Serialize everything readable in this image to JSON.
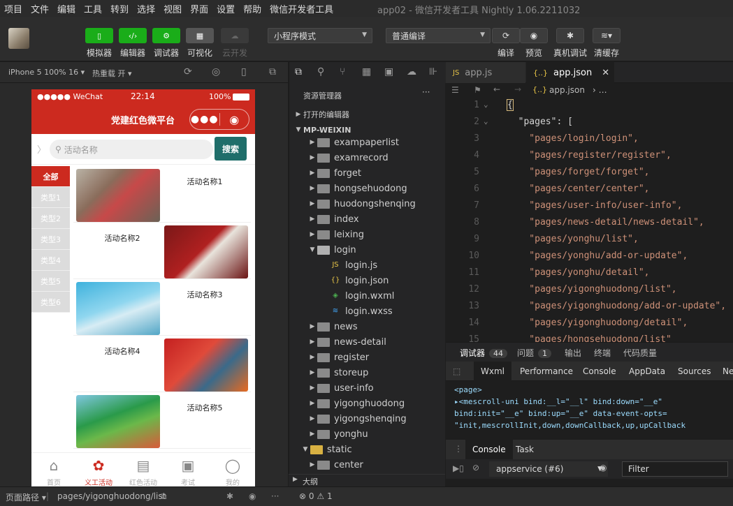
{
  "menu": [
    "项目",
    "文件",
    "编辑",
    "工具",
    "转到",
    "选择",
    "视图",
    "界面",
    "设置",
    "帮助",
    "微信开发者工具"
  ],
  "window_title": "app02 - 微信开发者工具 Nightly 1.06.2211032",
  "toolbar": {
    "simulator": "模拟器",
    "editor": "编辑器",
    "debugger": "调试器",
    "visual": "可视化",
    "cloud": "云开发",
    "mode_select": "小程序模式",
    "compile_select": "普通编译",
    "compile": "编译",
    "preview": "预览",
    "device_debug": "真机调试",
    "clear_cache": "清缓存"
  },
  "devbar": {
    "device": "iPhone 5 100% 16",
    "hot_reload": "热重载 开"
  },
  "phone": {
    "carrier": "●●●●● WeChat",
    "time": "22:14",
    "battery": "100%",
    "nav_title": "党建红色微平台",
    "search_placeholder": "活动名称",
    "search_button": "搜索",
    "categories": [
      "全部",
      "类型1",
      "类型2",
      "类型3",
      "类型4",
      "类型5",
      "类型6"
    ],
    "cards": [
      {
        "title": "活动名称1",
        "img_side": "left"
      },
      {
        "title": "活动名称2",
        "img_side": "right"
      },
      {
        "title": "活动名称3",
        "img_side": "left"
      },
      {
        "title": "活动名称4",
        "img_side": "right"
      },
      {
        "title": "活动名称5",
        "img_side": "left"
      }
    ],
    "tabs": [
      {
        "label": "首页",
        "icon": "home-icon",
        "glyph": "⌂"
      },
      {
        "label": "义工活动",
        "icon": "activity-icon",
        "glyph": "✿"
      },
      {
        "label": "红色活动",
        "icon": "calendar-icon",
        "glyph": "▤"
      },
      {
        "label": "考试",
        "icon": "exam-icon",
        "glyph": "▣"
      },
      {
        "label": "我的",
        "icon": "user-icon",
        "glyph": "◯"
      }
    ]
  },
  "explorer": {
    "header": "资源管理器",
    "open_editors": "打开的编辑器",
    "project": "MP-WEIXIN",
    "outline": "大纲",
    "items": [
      {
        "name": "exampaperlist",
        "type": "folder",
        "level": 1
      },
      {
        "name": "examrecord",
        "type": "folder",
        "level": 1
      },
      {
        "name": "forget",
        "type": "folder",
        "level": 1
      },
      {
        "name": "hongsehuodong",
        "type": "folder",
        "level": 1
      },
      {
        "name": "huodongshenqing",
        "type": "folder",
        "level": 1
      },
      {
        "name": "index",
        "type": "folder",
        "level": 1
      },
      {
        "name": "leixing",
        "type": "folder",
        "level": 1
      },
      {
        "name": "login",
        "type": "folder-open",
        "level": 1
      },
      {
        "name": "login.js",
        "type": "js",
        "level": 2
      },
      {
        "name": "login.json",
        "type": "json",
        "level": 2
      },
      {
        "name": "login.wxml",
        "type": "wxml",
        "level": 2
      },
      {
        "name": "login.wxss",
        "type": "wxss",
        "level": 2
      },
      {
        "name": "news",
        "type": "folder",
        "level": 1
      },
      {
        "name": "news-detail",
        "type": "folder",
        "level": 1
      },
      {
        "name": "register",
        "type": "folder",
        "level": 1
      },
      {
        "name": "storeup",
        "type": "folder",
        "level": 1
      },
      {
        "name": "user-info",
        "type": "folder",
        "level": 1
      },
      {
        "name": "yigonghuodong",
        "type": "folder",
        "level": 1
      },
      {
        "name": "yigongshenqing",
        "type": "folder",
        "level": 1
      },
      {
        "name": "yonghu",
        "type": "folder",
        "level": 1
      },
      {
        "name": "static",
        "type": "folder-static",
        "level": 0
      },
      {
        "name": "center",
        "type": "folder",
        "level": 1
      }
    ]
  },
  "editor": {
    "tabs": [
      {
        "label": "app.js",
        "icon": "JS"
      },
      {
        "label": "app.json",
        "icon": "{..}"
      }
    ],
    "breadcrumb": "app.json",
    "lines": [
      {
        "n": "1",
        "text": "{"
      },
      {
        "n": "2",
        "text": "  \"pages\": ["
      },
      {
        "n": "3",
        "text": "    \"pages/login/login\","
      },
      {
        "n": "4",
        "text": "    \"pages/register/register\","
      },
      {
        "n": "5",
        "text": "    \"pages/forget/forget\","
      },
      {
        "n": "6",
        "text": "    \"pages/center/center\","
      },
      {
        "n": "7",
        "text": "    \"pages/user-info/user-info\","
      },
      {
        "n": "8",
        "text": "    \"pages/news-detail/news-detail\","
      },
      {
        "n": "9",
        "text": "    \"pages/yonghu/list\","
      },
      {
        "n": "10",
        "text": "    \"pages/yonghu/add-or-update\","
      },
      {
        "n": "11",
        "text": "    \"pages/yonghu/detail\","
      },
      {
        "n": "12",
        "text": "    \"pages/yigonghuodong/list\","
      },
      {
        "n": "13",
        "text": "    \"pages/yigonghuodong/add-or-update\","
      },
      {
        "n": "14",
        "text": "    \"pages/yigonghuodong/detail\","
      },
      {
        "n": "15",
        "text": "    \"pages/hongsehuodong/list\""
      }
    ]
  },
  "debugger": {
    "tab_debugger": "调试器",
    "debugger_count": "44",
    "tab_issues": "问题",
    "issues_count": "1",
    "tab_output": "输出",
    "tab_terminal": "终端",
    "tab_quality": "代码质量",
    "subtabs": [
      "Wxml",
      "Performance",
      "Console",
      "AppData",
      "Sources",
      "Ne"
    ],
    "wxml_lines": [
      "<page>",
      "▸<mescroll-uni bind:__l=\"__l\" bind:down=\"__e\"",
      "bind:init=\"__e\" bind:up=\"__e\" data-event-opts=",
      "\"init,mescrollInit,down,downCallback,up,upCallback"
    ],
    "console_tab": "Console",
    "task_tab": "Task",
    "context": "appservice (#6)",
    "filter_placeholder": "Filter"
  },
  "statusbar": {
    "page_path_label": "页面路径",
    "page_path": "pages/yigonghuodong/list",
    "errors": "0",
    "warnings": "1"
  }
}
